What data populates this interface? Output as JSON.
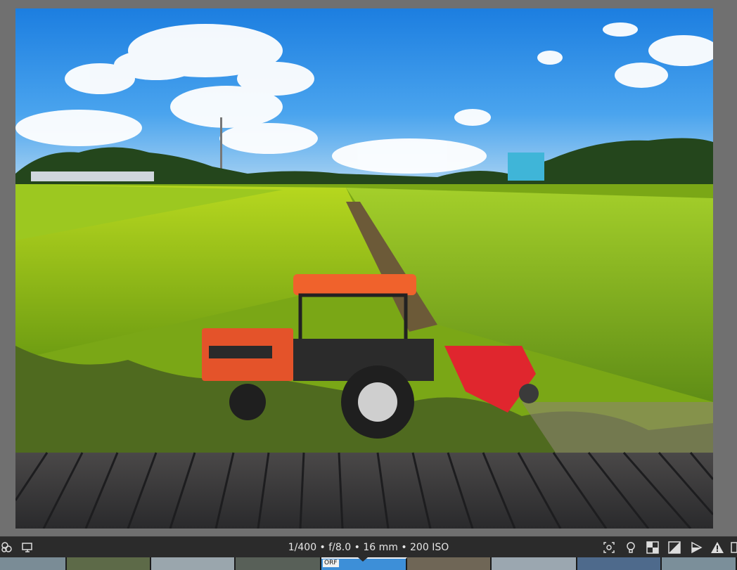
{
  "exif_text": "1/400 • f/8.0 • 16 mm • 200 ISO",
  "filmstrip": {
    "active_label": "ORF"
  },
  "icons": {
    "left": [
      "styles-icon",
      "display-icon"
    ],
    "right": [
      "focus-icon",
      "bulb-icon",
      "checker-icon",
      "exposure-icon",
      "softproof-icon",
      "warning-icon",
      "split-icon"
    ]
  },
  "colors": {
    "sky": "#2a8ee6",
    "field": "#8cc21a",
    "tractor": "#ec5a2a",
    "deck": "#3a3838"
  }
}
